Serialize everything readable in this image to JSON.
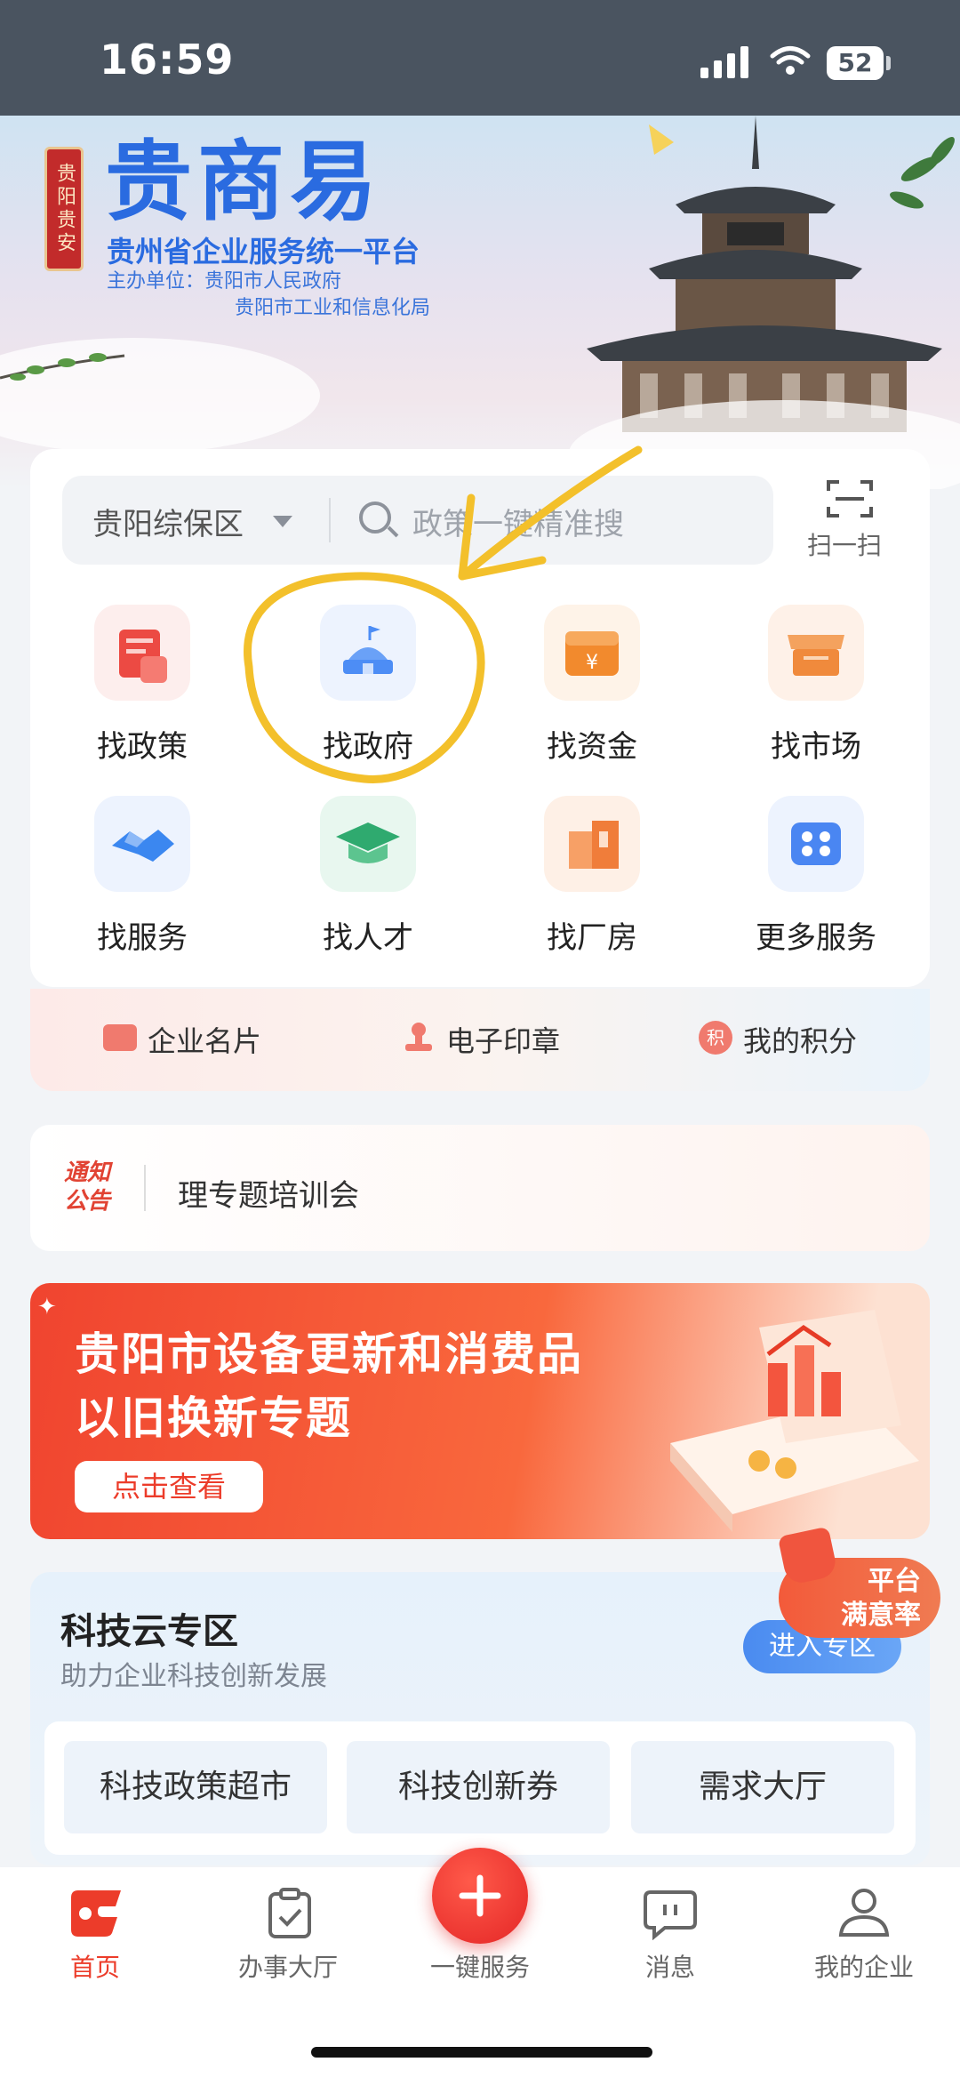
{
  "status_bar": {
    "time": "16:59",
    "battery": "52"
  },
  "hero": {
    "seal_text": "贵阳贵安",
    "brand": "贵商易",
    "subtitle": "贵州省企业服务统一平台",
    "host_line1": "主办单位：贵阳市人民政府",
    "host_line2": "贵阳市工业和信息化局"
  },
  "search": {
    "region": "贵阳综保区",
    "placeholder": "政策一键精准搜",
    "scan_label": "扫一扫"
  },
  "services": [
    {
      "label": "找政策",
      "icon": "policy-document-icon",
      "color": "#ec4a43"
    },
    {
      "label": "找政府",
      "icon": "government-building-icon",
      "color": "#4d8df5"
    },
    {
      "label": "找资金",
      "icon": "funding-wallet-icon",
      "color": "#f28a2d"
    },
    {
      "label": "找市场",
      "icon": "market-shop-icon",
      "color": "#f08a3c"
    },
    {
      "label": "找服务",
      "icon": "handshake-icon",
      "color": "#3b87f0"
    },
    {
      "label": "找人才",
      "icon": "graduation-cap-icon",
      "color": "#2faa6f"
    },
    {
      "label": "找厂房",
      "icon": "factory-building-icon",
      "color": "#f07d3a"
    },
    {
      "label": "更多服务",
      "icon": "more-apps-icon",
      "color": "#4a86f2"
    }
  ],
  "shortcuts": [
    {
      "label": "企业名片",
      "icon": "business-card-icon"
    },
    {
      "label": "电子印章",
      "icon": "stamp-icon"
    },
    {
      "label": "我的积分",
      "icon": "points-coin-icon",
      "icon_text": "积"
    }
  ],
  "notice": {
    "badge_line1": "通知",
    "badge_line2": "公告",
    "text": "​‌﻿理专题培训会"
  },
  "banner": {
    "title_line1": "贵阳市设备更新和消费品",
    "title_line2": "以旧换新专题",
    "button": "点击查看"
  },
  "tech_zone": {
    "title": "科技云专区",
    "subtitle": "助力企业科技创新发展",
    "enter_button": "进入专区",
    "items": [
      "科技政策超市",
      "科技创新券",
      "需求大厅"
    ]
  },
  "float_badge": {
    "line1": "平台",
    "line2": "满意率"
  },
  "tabbar": {
    "items": [
      {
        "label": "首页",
        "icon": "home-logo-icon",
        "active": true
      },
      {
        "label": "办事大厅",
        "icon": "clipboard-check-icon",
        "active": false
      },
      {
        "label": "一键服务",
        "icon": "plus-icon",
        "active": false
      },
      {
        "label": "消息",
        "icon": "message-bubble-icon",
        "active": false
      },
      {
        "label": "我的企业",
        "icon": "enterprise-user-icon",
        "active": false
      }
    ]
  },
  "colors": {
    "brand": "#2a6be0",
    "accent": "#ec3c2a",
    "annotation": "#f3c02b"
  }
}
